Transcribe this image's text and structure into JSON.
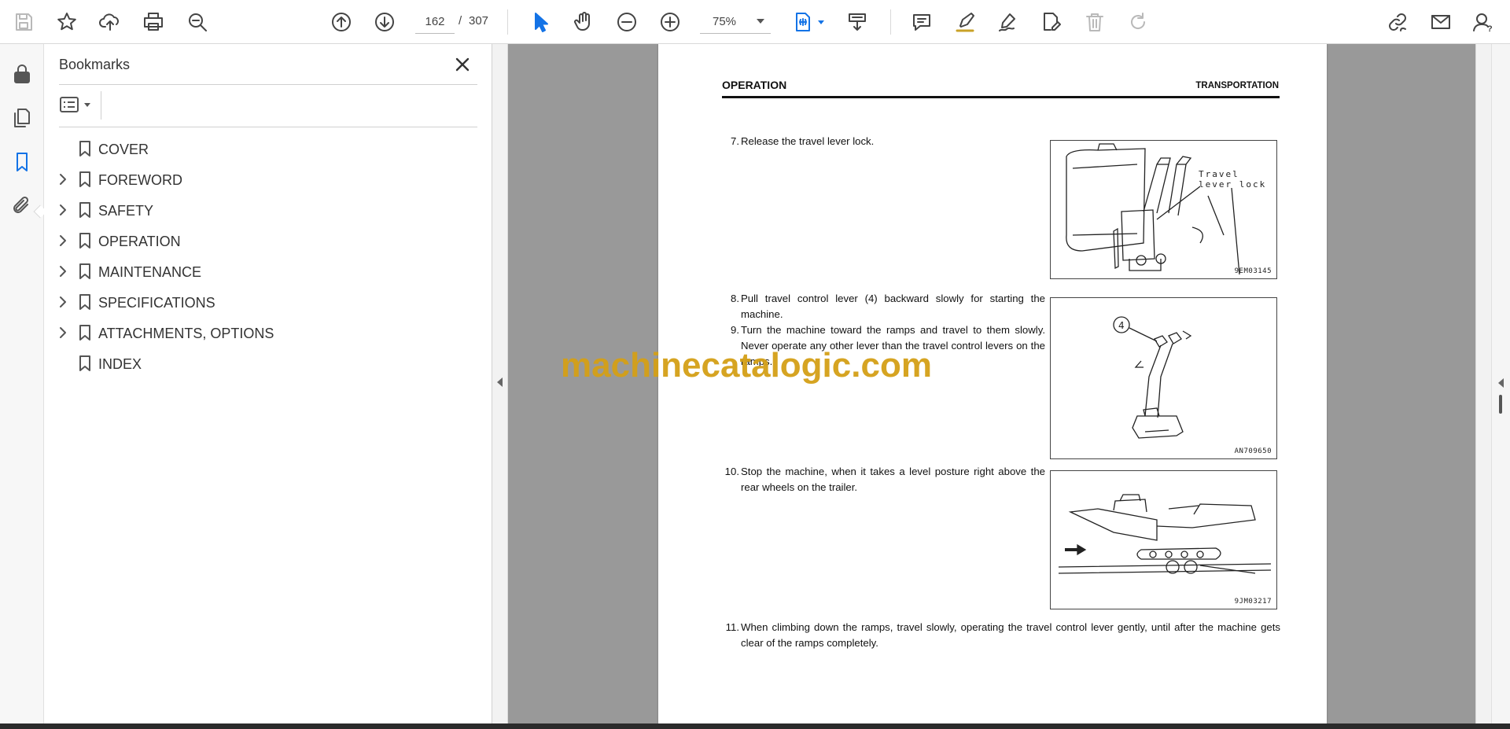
{
  "toolbar": {
    "page_current": "162",
    "page_separator": "/",
    "page_total": "307",
    "zoom": "75%"
  },
  "bookmarks": {
    "title": "Bookmarks",
    "items": [
      {
        "label": "COVER",
        "expandable": false
      },
      {
        "label": "FOREWORD",
        "expandable": true
      },
      {
        "label": "SAFETY",
        "expandable": true
      },
      {
        "label": "OPERATION",
        "expandable": true
      },
      {
        "label": "MAINTENANCE",
        "expandable": true
      },
      {
        "label": "SPECIFICATIONS",
        "expandable": true
      },
      {
        "label": "ATTACHMENTS, OPTIONS",
        "expandable": true
      },
      {
        "label": "INDEX",
        "expandable": false
      }
    ]
  },
  "document": {
    "header_left": "OPERATION",
    "header_right": "TRANSPORTATION",
    "steps": [
      {
        "num": "7.",
        "text": "Release the travel lever lock."
      },
      {
        "num": "8.",
        "text": "Pull travel control lever (4) backward slowly for starting the machine."
      },
      {
        "num": "9.",
        "text": "Turn the machine toward the ramps and travel to them slowly. Never operate any other lever than the travel control levers on the ramps."
      },
      {
        "num": "10.",
        "text": "Stop the machine, when it takes a level posture right above the rear wheels on the trailer."
      },
      {
        "num": "11.",
        "text": "When climbing down the ramps, travel slowly, operating the travel control lever gently, until after the machine gets clear of the ramps completely."
      }
    ],
    "figures": [
      {
        "code": "9EM03145",
        "callout": "Travel lever lock"
      },
      {
        "code": "AN709650",
        "callout": "4"
      },
      {
        "code": "9JM03217"
      }
    ]
  },
  "watermark": "machinecatalogic.com"
}
